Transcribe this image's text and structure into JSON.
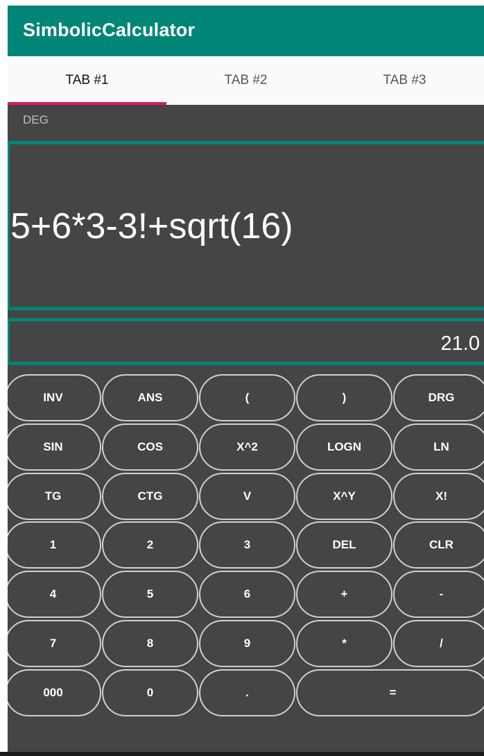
{
  "app": {
    "title": "SimbolicCalculator"
  },
  "tabs": [
    {
      "label": "TAB #1",
      "active": true
    },
    {
      "label": "TAB #2",
      "active": false
    },
    {
      "label": "TAB #3",
      "active": false
    }
  ],
  "display": {
    "angle_mode": "DEG",
    "expression": "5+6*3-3!+sqrt(16)",
    "result": "21.0"
  },
  "keypad": {
    "rows": [
      [
        "INV",
        "ANS",
        "(",
        ")",
        "DRG"
      ],
      [
        "SIN",
        "COS",
        "X^2",
        "LOGN",
        "LN"
      ],
      [
        "TG",
        "CTG",
        "V",
        "X^Y",
        "X!"
      ],
      [
        "1",
        "2",
        "3",
        "DEL",
        "CLR"
      ],
      [
        "4",
        "5",
        "6",
        "+",
        "-"
      ],
      [
        "7",
        "8",
        "9",
        "*",
        "/"
      ],
      [
        "000",
        "0",
        ".",
        "="
      ]
    ]
  },
  "colors": {
    "primary": "#008577",
    "accent": "#D81B60",
    "background": "#454545"
  }
}
